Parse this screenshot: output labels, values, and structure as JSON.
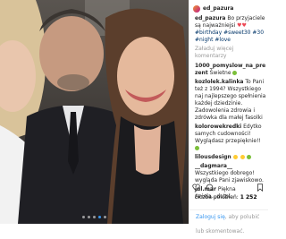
{
  "post": {
    "username": "ed_pazura",
    "caption_text": "Bo przyjaciele są najważniejsi",
    "caption_tags": "#birthday #sweet30 #30 #night #love",
    "view_more": "Załaduj więcej komentarzy",
    "comments": [
      {
        "user": "1000_pomyslow_na_prezent",
        "text": "Świetne"
      },
      {
        "user": "kozlolek.kalinka",
        "text": "To Pani też z 1994? Wszystkiego naj najlepszego spełnienia każdej dziedzinie. Zadowolenia zdrowia i zdrówka dla małej fasolki"
      },
      {
        "user": "kolorowekredki",
        "text": "Edytko samych cudowności! Wyglądasz przepięknie!!"
      },
      {
        "user": "lilousdesign",
        "text": ""
      },
      {
        "user": "__dagmara__",
        "text": "Wszystkiego dobrego! wygląda Pani zjawiskowo."
      },
      {
        "user": "jul.mar",
        "text": "Piękna Aniela...dutol"
      }
    ],
    "likes_label": "Liczba polubień:",
    "likes_count": "1 252",
    "date": "",
    "footer_login": "Zaloguj się",
    "footer_text": "aby polubić lub skomentować."
  },
  "colors": {
    "link": "#003569",
    "accent": "#3897f0",
    "heart": "#ed4956"
  },
  "carousel": {
    "total": 5,
    "active": 4
  }
}
